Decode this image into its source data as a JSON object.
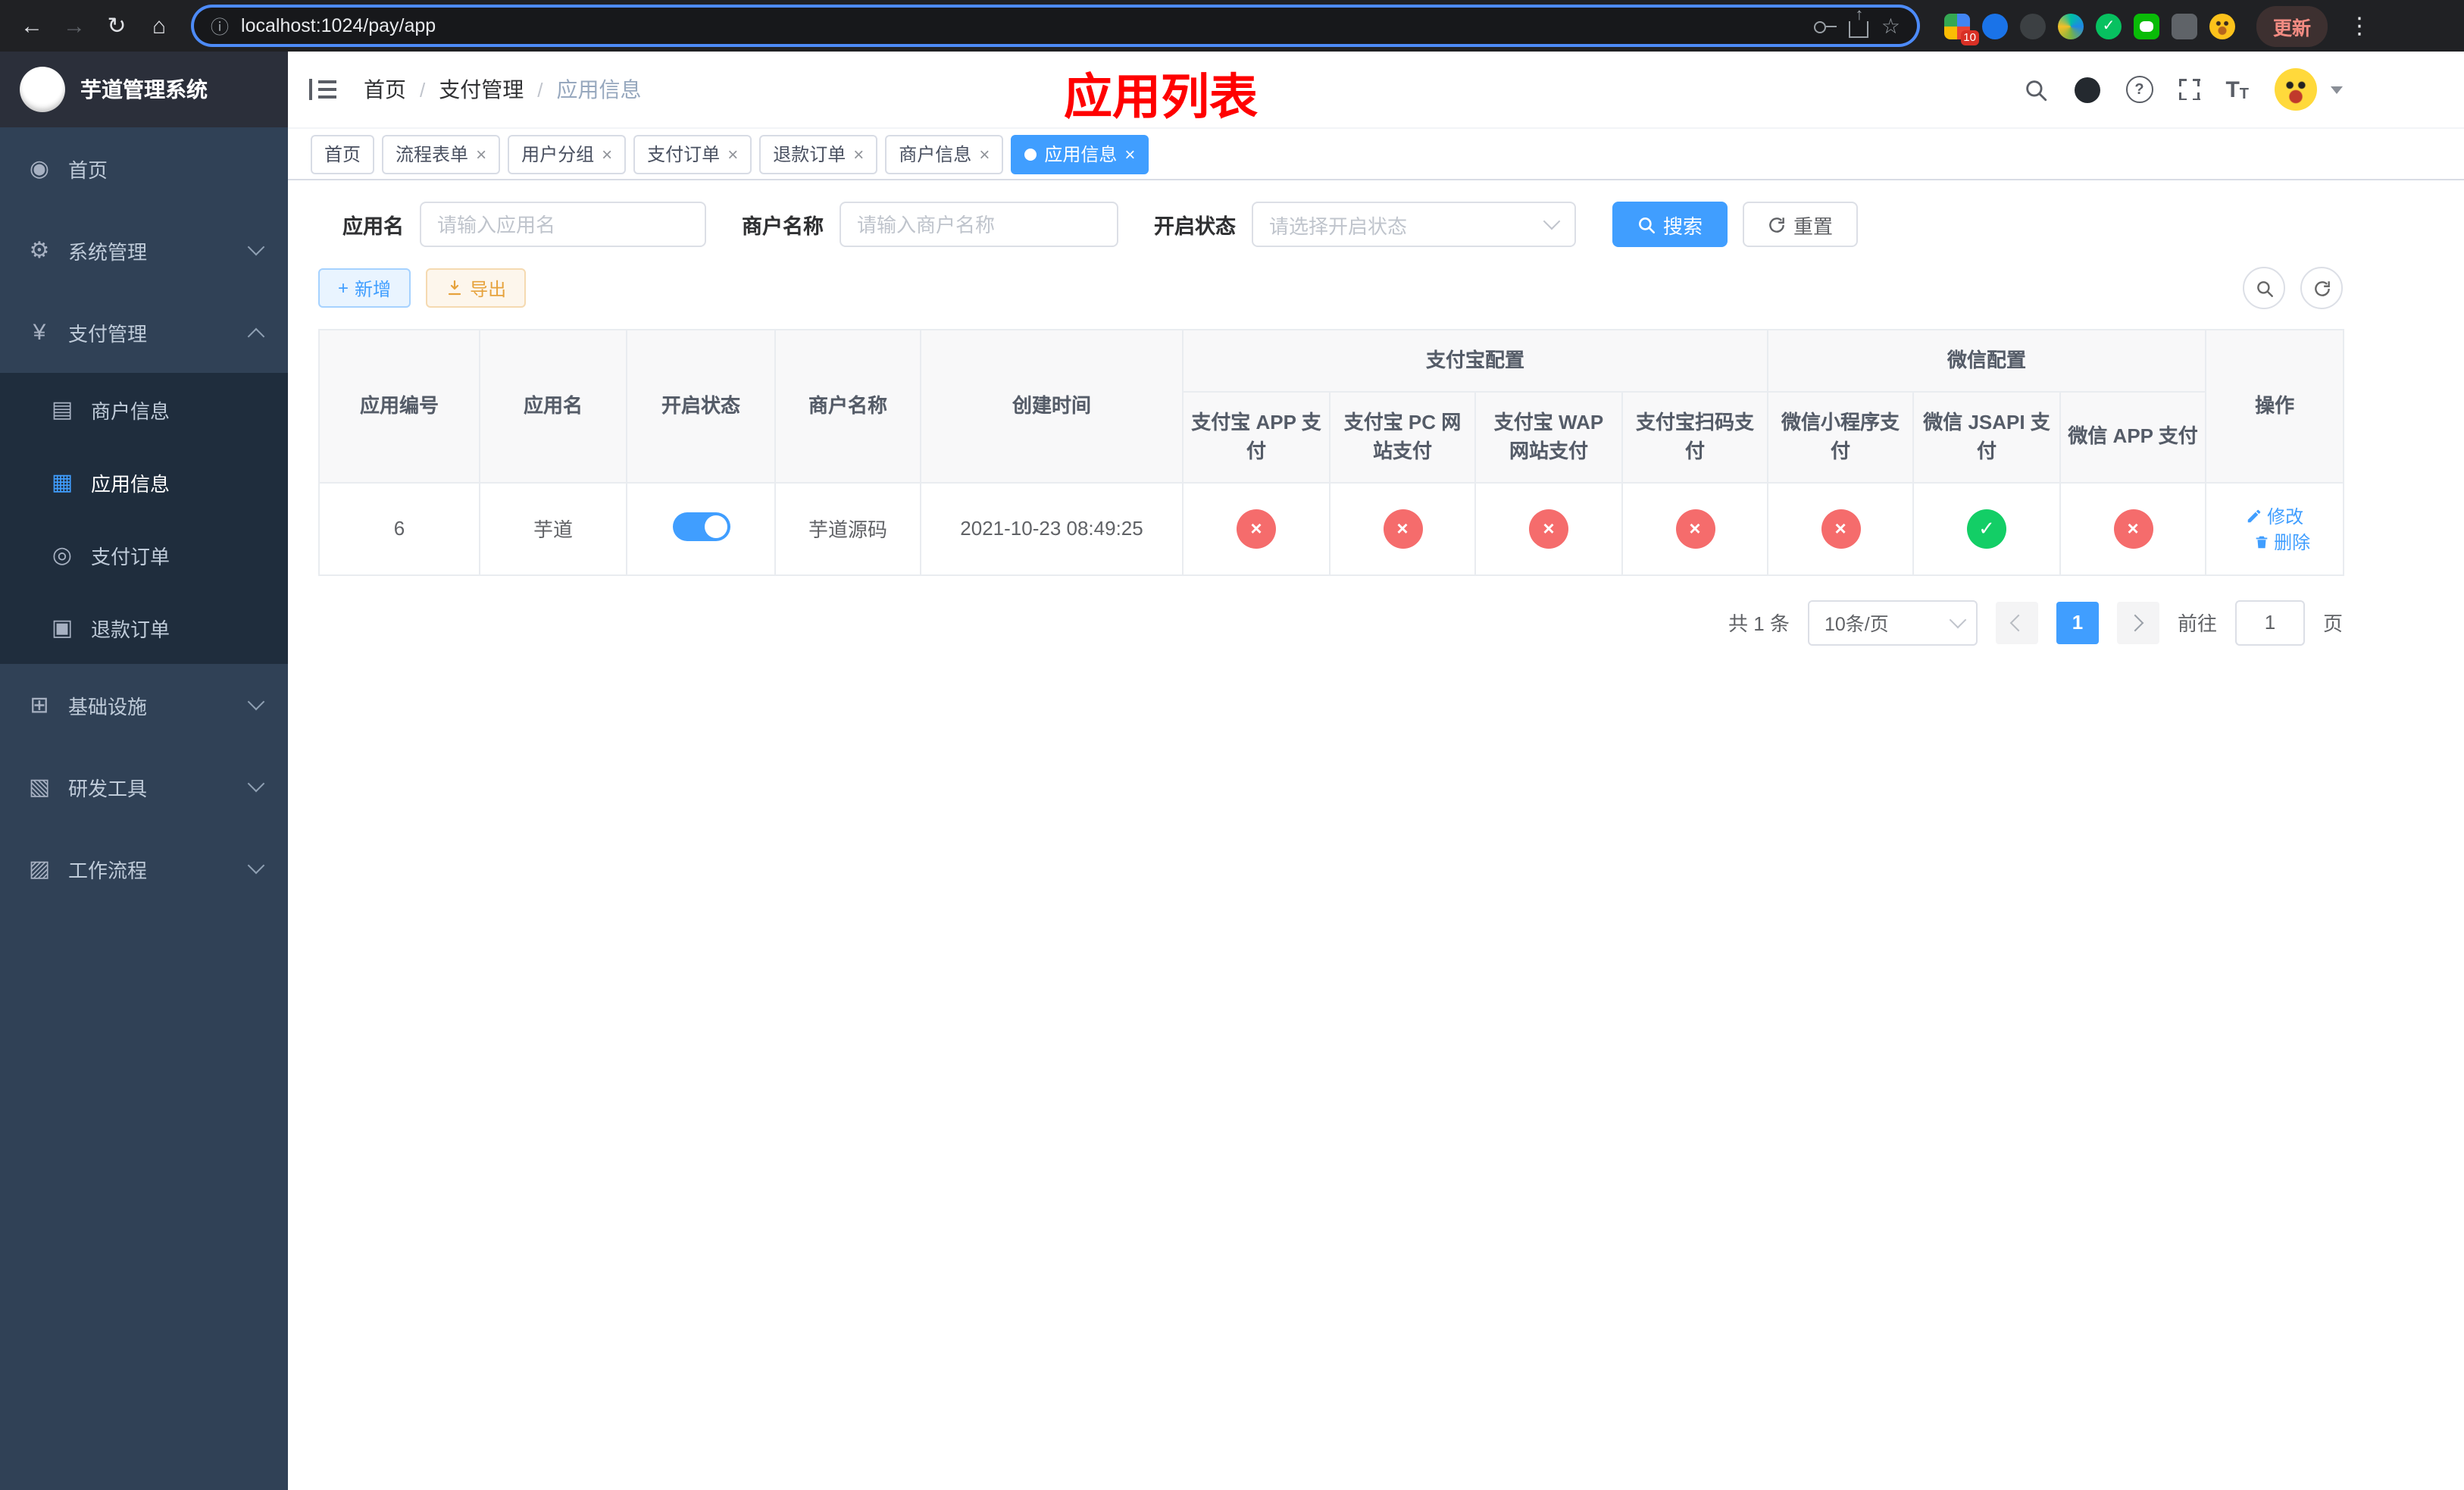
{
  "browser": {
    "url": "localhost:1024/pay/app",
    "update_label": "更新",
    "extension_badge": "10"
  },
  "overlay": {
    "title": "应用列表",
    "color": "#ff0000"
  },
  "colors": {
    "accent": "#409eff",
    "danger": "#f56c6c",
    "success": "#13ce66",
    "warning": "#e6a23c"
  },
  "icons": {
    "back": "←",
    "forward": "→",
    "reload": "↻",
    "home": "⌂",
    "info": "ⓘ",
    "star": "☆",
    "dots": "⋮",
    "close": "×",
    "check": "✓",
    "cross": "×",
    "question": "?",
    "plus": "+",
    "font_big": "T",
    "font_small": "T"
  },
  "sidebar": {
    "title": "芋道管理系统",
    "items": [
      {
        "label": "首页",
        "icon": "dashboard",
        "glyph": "◉"
      },
      {
        "label": "系统管理",
        "icon": "gear",
        "glyph": "⚙"
      },
      {
        "label": "支付管理",
        "icon": "yen",
        "glyph": "¥"
      },
      {
        "label": "商户信息",
        "icon": "merchant-card",
        "glyph": "▤"
      },
      {
        "label": "应用信息",
        "icon": "app-grid",
        "glyph": "▦"
      },
      {
        "label": "支付订单",
        "icon": "pay-order",
        "glyph": "◎"
      },
      {
        "label": "退款订单",
        "icon": "refund-order",
        "glyph": "▣"
      },
      {
        "label": "基础设施",
        "icon": "infrastructure",
        "glyph": "⊞"
      },
      {
        "label": "研发工具",
        "icon": "dev-tools",
        "glyph": "▧"
      },
      {
        "label": "工作流程",
        "icon": "workflow",
        "glyph": "▨"
      }
    ]
  },
  "breadcrumb": {
    "items": [
      "首页",
      "支付管理",
      "应用信息"
    ],
    "separator": "/"
  },
  "tabs": [
    {
      "label": "首页"
    },
    {
      "label": "流程表单"
    },
    {
      "label": "用户分组"
    },
    {
      "label": "支付订单"
    },
    {
      "label": "退款订单"
    },
    {
      "label": "商户信息"
    },
    {
      "label": "应用信息"
    }
  ],
  "filters": {
    "app_name": {
      "label": "应用名",
      "placeholder": "请输入应用名",
      "value": ""
    },
    "merchant_name": {
      "label": "商户名称",
      "placeholder": "请输入商户名称",
      "value": ""
    },
    "status": {
      "label": "开启状态",
      "placeholder": "请选择开启状态",
      "value": ""
    },
    "search_label": "搜索",
    "reset_label": "重置"
  },
  "toolbar": {
    "add_label": "新增",
    "export_label": "导出"
  },
  "table": {
    "headers": {
      "app_id": "应用编号",
      "app_name": "应用名",
      "status": "开启状态",
      "merchant": "商户名称",
      "created": "创建时间",
      "alipay_group": "支付宝配置",
      "wechat_group": "微信配置",
      "alipay_app": "支付宝 APP 支付",
      "alipay_pc": "支付宝 PC 网站支付",
      "alipay_wap": "支付宝 WAP 网站支付",
      "alipay_qr": "支付宝扫码支付",
      "wechat_mini": "微信小程序支付",
      "wechat_jsapi": "微信 JSAPI 支付",
      "wechat_app": "微信 APP 支付",
      "actions": "操作"
    },
    "rows": [
      {
        "app_id": "6",
        "app_name": "芋道",
        "enabled": true,
        "merchant": "芋道源码",
        "created": "2021-10-23 08:49:25",
        "configs": [
          false,
          false,
          false,
          false,
          false,
          true,
          false
        ]
      }
    ],
    "row_actions": {
      "edit": "修改",
      "delete": "删除"
    }
  },
  "pagination": {
    "total": "共 1 条",
    "page_size": "10条/页",
    "page": "1",
    "goto_label": "前往",
    "goto_value": "1",
    "page_unit": "页"
  }
}
